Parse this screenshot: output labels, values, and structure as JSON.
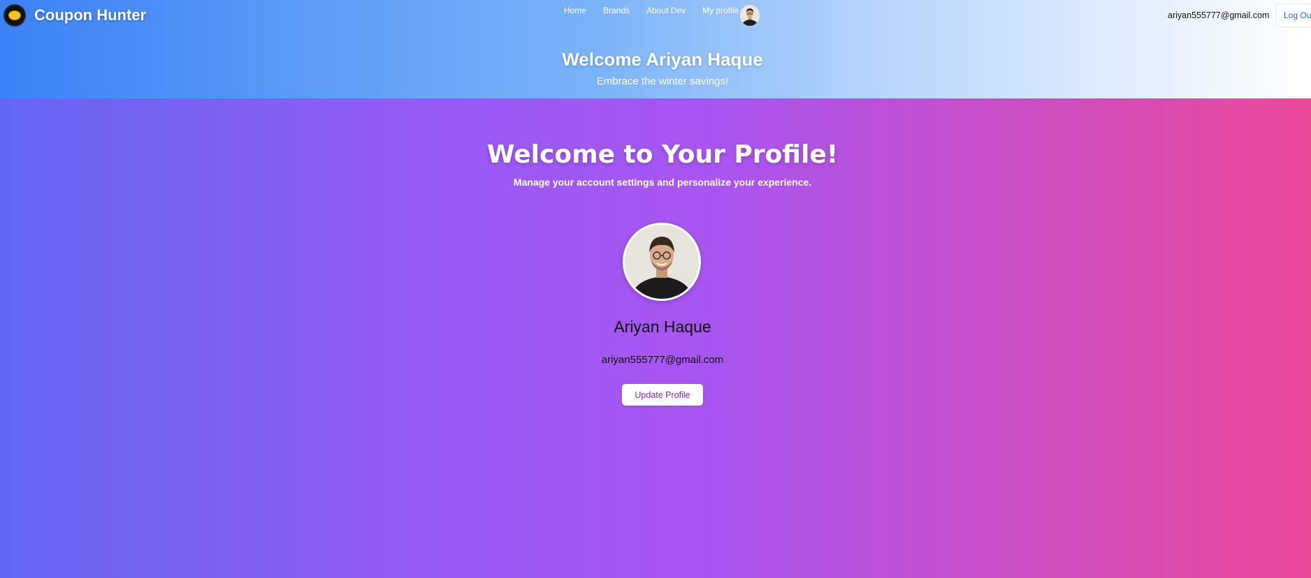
{
  "header": {
    "brand": "Coupon Hunter",
    "nav": [
      {
        "label": "Home"
      },
      {
        "label": "Brands"
      },
      {
        "label": "About Dev"
      },
      {
        "label": "My profile"
      }
    ],
    "user_email": "ariyan555777@gmail.com",
    "logout_label": "Log Out",
    "welcome": "Welcome Ariyan Haque",
    "tagline": "Embrace the winter savings!"
  },
  "profile": {
    "title": "Welcome to Your Profile!",
    "subtitle": "Manage your account settings and personalize your experience.",
    "name": "Ariyan Haque",
    "email": "ariyan555777@gmail.com",
    "update_label": "Update Profile"
  },
  "colors": {
    "header_start": "#3b82f6",
    "main_start": "#6366f1",
    "main_mid": "#a855f7",
    "main_end": "#ec4899",
    "link_blue": "#2563eb",
    "button_text": "#7e22ce"
  }
}
